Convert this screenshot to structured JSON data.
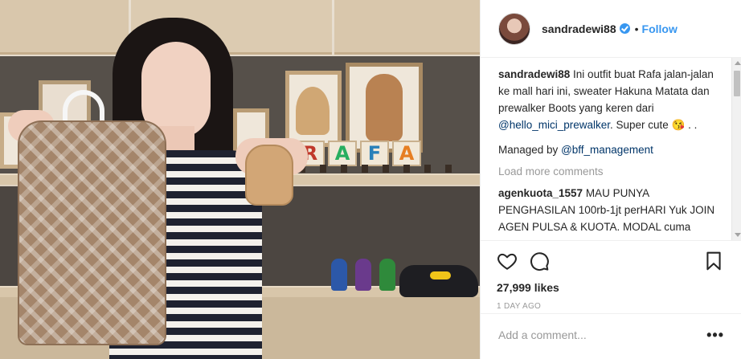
{
  "post": {
    "username": "sandradewi88",
    "separator": "•",
    "follow_label": "Follow",
    "caption": {
      "username": "sandradewi88",
      "text_before": " Ini outfit buat Rafa jalan-jalan ke mall hari ini, sweater Hakuna Matata dan prewalker Boots yang keren dari ",
      "mention": "@hello_mici_prewalker",
      "text_after": ". Super cute 😘 . ."
    },
    "managed": {
      "text": "Managed by ",
      "mention": "@bff_management"
    },
    "load_more": "Load more comments",
    "comments": [
      {
        "username": "agenkuota_1557",
        "text": " MAU PUNYA PENGHASILAN 100rb-1jt perHARI Yuk JOIN AGEN PULSA & KUOTA. MODAL cuma"
      }
    ],
    "likes": "27,999 likes",
    "timestamp": "1 DAY AGO",
    "add_comment_placeholder": "Add a comment...",
    "more_label": "•••"
  },
  "photo": {
    "blocks": [
      "R",
      "A",
      "F",
      "A"
    ],
    "block_colors": [
      "#c0392b",
      "#27ae60",
      "#2980b9",
      "#e67e22"
    ]
  },
  "icons": {
    "like": "heart-icon",
    "comment": "comment-bubble-icon",
    "save": "bookmark-icon",
    "verified": "verified-badge-icon"
  }
}
